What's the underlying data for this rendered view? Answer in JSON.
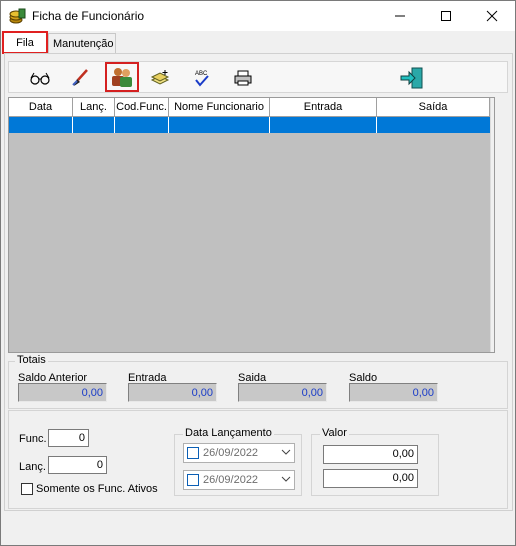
{
  "window": {
    "title": "Ficha de Funcionário"
  },
  "tabs": [
    {
      "label": "Fila",
      "active": true
    },
    {
      "label": "Manutenção",
      "active": false
    }
  ],
  "toolbar": {
    "items": [
      {
        "icon": "glasses-icon"
      },
      {
        "icon": "brush-icon"
      },
      {
        "icon": "users-icon",
        "selected": true
      },
      {
        "icon": "add-record-icon"
      },
      {
        "icon": "spellcheck-icon"
      },
      {
        "icon": "printer-icon"
      },
      {
        "icon": "exit-door-icon"
      }
    ]
  },
  "grid": {
    "columns": [
      "Data",
      "Lanç.",
      "Cod.Func.",
      "Nome Funcionario",
      "Entrada",
      "Saída"
    ],
    "rows": [
      [
        "",
        "",
        "",
        "",
        "",
        ""
      ]
    ],
    "selected_row_color": "#0078d7"
  },
  "totais": {
    "legend": "Totais",
    "saldo_anterior_label": "Saldo Anterior",
    "saldo_anterior_value": "0,00",
    "entrada_label": "Entrada",
    "entrada_value": "0,00",
    "saida_label": "Saida",
    "saida_value": "0,00",
    "saldo_label": "Saldo",
    "saldo_value": "0,00",
    "value_color": "#1a3cc8"
  },
  "filters": {
    "func_label": "Func.",
    "func_value": "0",
    "lanc_label": "Lanç.",
    "lanc_value": "0",
    "somente_label": "Somente os Func. Ativos",
    "data_lancamento_legend": "Data Lançamento",
    "date_from": "26/09/2022",
    "date_to": "26/09/2022",
    "valor_legend": "Valor",
    "valor_from": "0,00",
    "valor_to": "0,00"
  }
}
